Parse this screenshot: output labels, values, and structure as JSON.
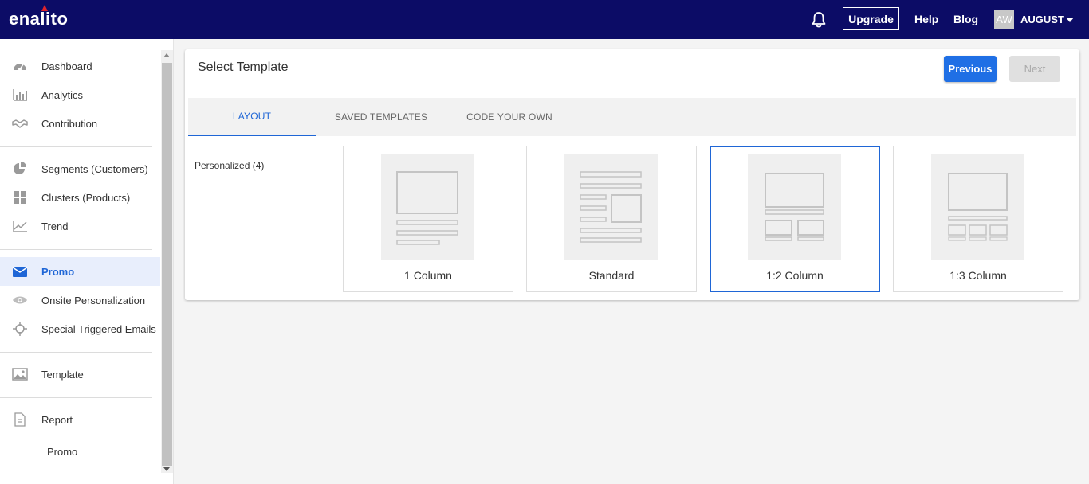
{
  "header": {
    "logo": "enalito",
    "upgrade_label": "Upgrade",
    "help_label": "Help",
    "blog_label": "Blog",
    "avatar_initials": "AW",
    "user_name": "AUGUST"
  },
  "sidebar": {
    "items": [
      {
        "label": "Dashboard",
        "icon": "dashboard-icon"
      },
      {
        "label": "Analytics",
        "icon": "bar-chart-icon"
      },
      {
        "label": "Contribution",
        "icon": "handshake-icon"
      },
      {
        "label": "Segments (Customers)",
        "icon": "pie-chart-icon"
      },
      {
        "label": "Clusters (Products)",
        "icon": "grid-icon"
      },
      {
        "label": "Trend",
        "icon": "trend-icon"
      },
      {
        "label": "Promo",
        "icon": "envelope-icon"
      },
      {
        "label": "Onsite Personalization",
        "icon": "eye-icon"
      },
      {
        "label": "Special Triggered Emails",
        "icon": "crosshair-icon"
      },
      {
        "label": "Template",
        "icon": "image-icon"
      },
      {
        "label": "Report",
        "icon": "document-icon"
      }
    ],
    "subitems": [
      {
        "label": "Promo"
      }
    ]
  },
  "main": {
    "title": "Select Template",
    "previous_label": "Previous",
    "next_label": "Next",
    "tabs": [
      {
        "label": "LAYOUT",
        "active": true
      },
      {
        "label": "SAVED TEMPLATES",
        "active": false
      },
      {
        "label": "CODE YOUR OWN",
        "active": false
      }
    ],
    "category": "Personalized (4)",
    "templates": [
      {
        "label": "1 Column",
        "selected": false
      },
      {
        "label": "Standard",
        "selected": false
      },
      {
        "label": "1:2 Column",
        "selected": true
      },
      {
        "label": "1:3 Column",
        "selected": false
      }
    ]
  },
  "colors": {
    "topbar": "#0c0c66",
    "accent": "#1f66d6",
    "primary_button": "#1f6fe5",
    "logo_mark": "#e0232b"
  }
}
